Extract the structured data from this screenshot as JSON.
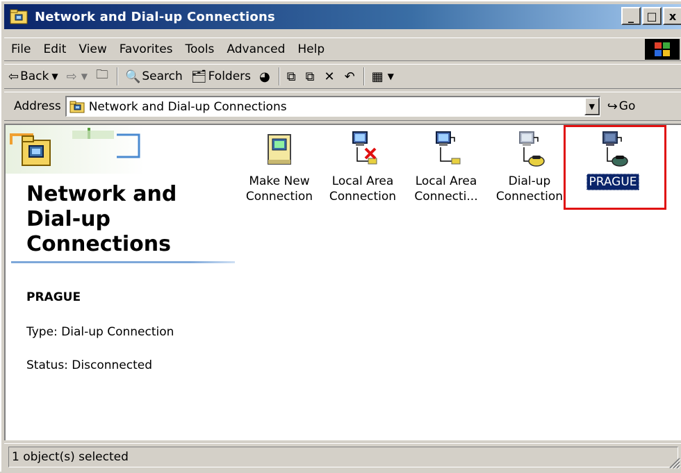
{
  "window": {
    "title": "Network and Dial-up Connections",
    "buttons": {
      "minimize": "_",
      "maximize": "□",
      "close": "x"
    }
  },
  "menu": [
    "File",
    "Edit",
    "View",
    "Favorites",
    "Tools",
    "Advanced",
    "Help"
  ],
  "toolbar": {
    "back": "Back",
    "search": "Search",
    "folders": "Folders"
  },
  "address": {
    "label": "Address",
    "value": "Network and Dial-up Connections",
    "go": "Go"
  },
  "left_panel": {
    "heading": "Network and Dial-up Connections",
    "selected_name": "PRAGUE",
    "type_text": "Type: Dial-up Connection",
    "status_text": "Status: Disconnected"
  },
  "icons": [
    {
      "label_line1": "Make New",
      "label_line2": "Connection",
      "icon": "make-new-connection-icon"
    },
    {
      "label_line1": "Local Area",
      "label_line2": "Connection",
      "icon": "lan-disconnected-icon"
    },
    {
      "label_line1": "Local Area",
      "label_line2": "Connecti...",
      "icon": "lan-connection-icon"
    },
    {
      "label_line1": "Dial-up",
      "label_line2": "Connection",
      "icon": "dialup-connection-icon"
    },
    {
      "label_line1": "PRAGUE",
      "label_line2": "",
      "icon": "prague-dialup-icon",
      "selected": true
    }
  ],
  "statusbar": {
    "text": "1 object(s) selected"
  },
  "colors": {
    "titlebar_start": "#0a246a",
    "titlebar_end": "#a6caf0",
    "selection": "#0a246a",
    "highlight": "#e01010",
    "chrome": "#d4d0c8"
  }
}
